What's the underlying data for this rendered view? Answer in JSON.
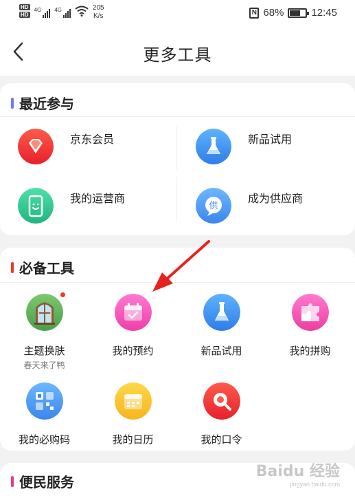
{
  "status_bar": {
    "hd1": "HD",
    "hd2": "HD",
    "net1": "4G",
    "net2": "4G",
    "speed_value": "205",
    "speed_unit": "K/s",
    "nfc": "N",
    "battery_percent": "68%",
    "battery_level": 0.68,
    "time": "12:45"
  },
  "nav": {
    "title": "更多工具"
  },
  "recent": {
    "title": "最近参与",
    "bar_color": "#6f7cf2",
    "items": [
      {
        "label": "京东会员",
        "icon": "diamond-icon"
      },
      {
        "label": "新品试用",
        "icon": "flask-icon"
      },
      {
        "label": "我的运营商",
        "icon": "phone-icon"
      },
      {
        "label": "成为供应商",
        "icon": "supplier-icon",
        "glyph": "供"
      }
    ]
  },
  "tools": {
    "title": "必备工具",
    "bar_color": "#f2392a",
    "items": [
      {
        "label": "主题换肤",
        "sub": "春天来了鸭",
        "icon": "window-theme-icon",
        "has_badge": true
      },
      {
        "label": "我的预约",
        "icon": "calendar-check-icon"
      },
      {
        "label": "新品试用",
        "icon": "flask-icon"
      },
      {
        "label": "我的拼购",
        "icon": "puzzle-icon"
      },
      {
        "label": "我的必购码",
        "icon": "qr-code-icon"
      },
      {
        "label": "我的日历",
        "icon": "calendar-icon"
      },
      {
        "label": "我的口令",
        "icon": "search-key-icon"
      }
    ]
  },
  "services": {
    "title": "便民服务",
    "bar_color": "#e83b8c"
  },
  "watermark": {
    "main": "Baidu 经验",
    "sub": "jingyan.baidu.com"
  }
}
